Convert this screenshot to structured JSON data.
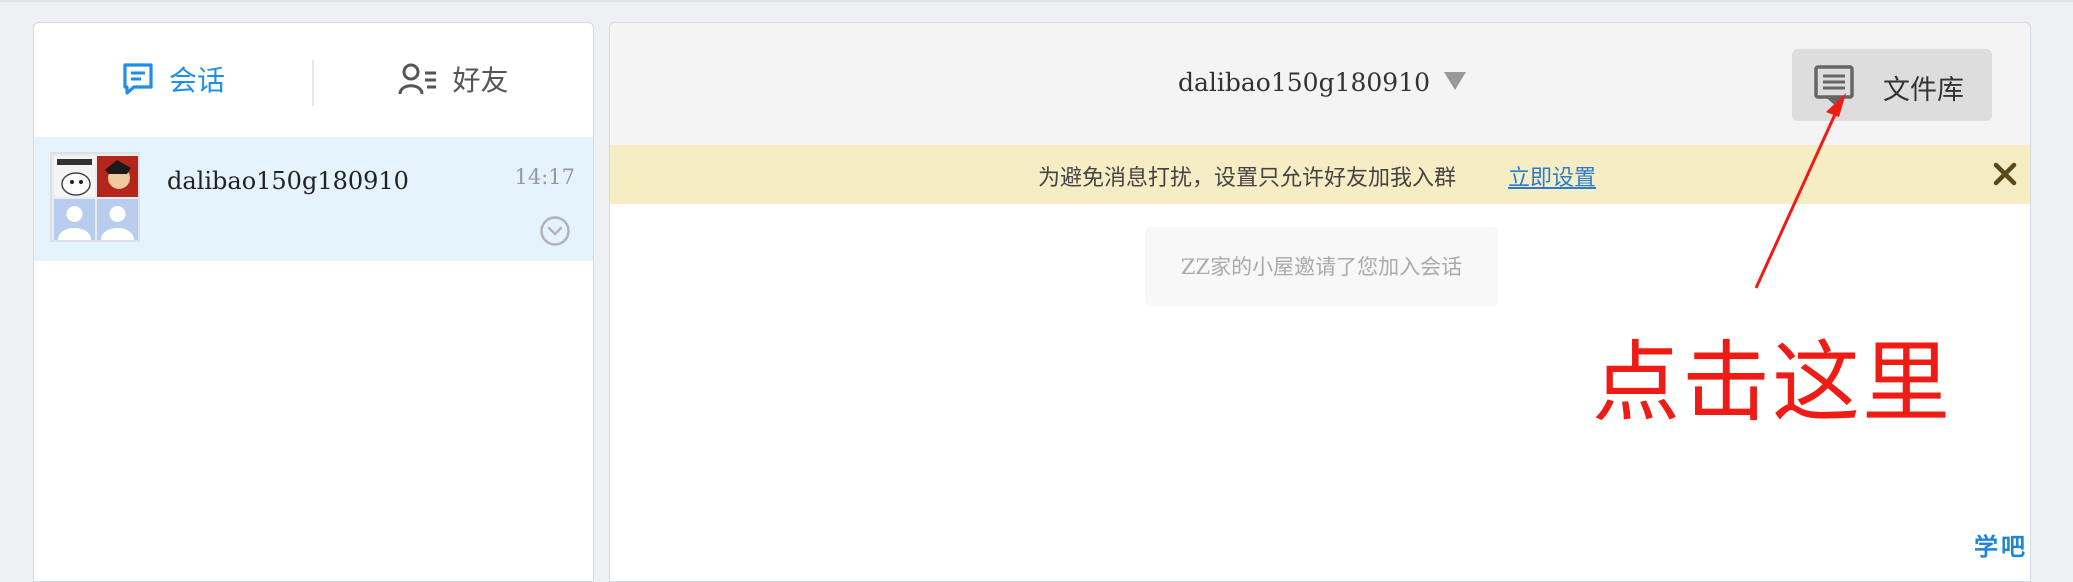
{
  "tabs": [
    {
      "label": "会话",
      "icon": "chat-bubble-icon",
      "active": true
    },
    {
      "label": "好友",
      "icon": "contacts-icon",
      "active": false
    }
  ],
  "conversations": [
    {
      "name": "dalibao150g180910",
      "time": "14:17"
    }
  ],
  "chat": {
    "title": "dalibao150g180910",
    "file_button": "文件库"
  },
  "notice": {
    "text": "为避免消息打扰，设置只允许好友加我入群",
    "link": "立即设置"
  },
  "messages": {
    "system": "ZZ家的小屋邀请了您加入会话"
  },
  "annotation": {
    "text": "点击这里",
    "color": "#ef1c16"
  },
  "watermark": "学吧",
  "colors": {
    "accent": "#1f8ee8",
    "selected_bg": "#e5f3fd",
    "notice_bg": "#f7edc4"
  }
}
